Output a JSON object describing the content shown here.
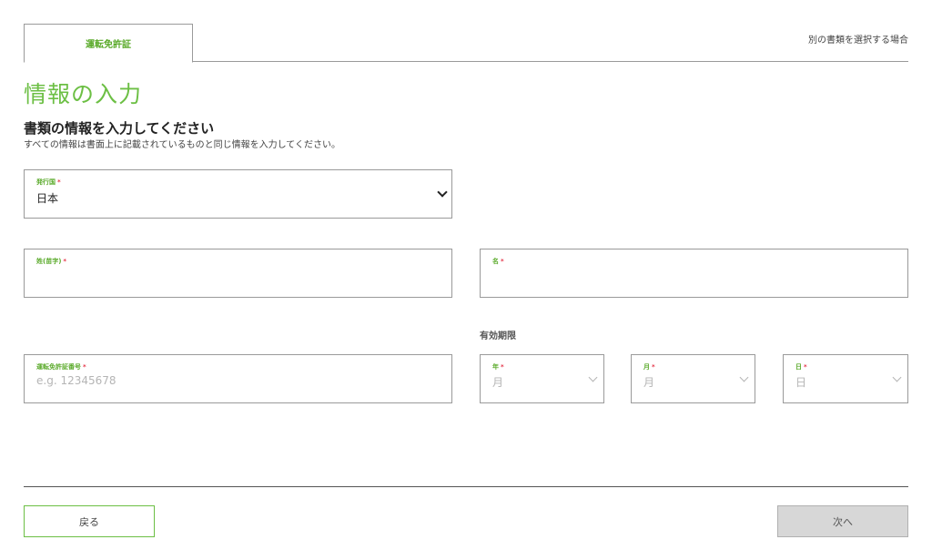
{
  "tabs": {
    "active_label": "運転免許証",
    "alt_link": "別の書類を選択する場合"
  },
  "page_title": "情報の入力",
  "section": {
    "heading": "書類の情報を入力してください",
    "description": "すべての情報は書面上に記載されているものと同じ情報を入力してください。"
  },
  "form": {
    "country": {
      "label": "発行国",
      "required_mark": "*",
      "value": "日本"
    },
    "last_name": {
      "label": "姓(苗字)",
      "required_mark": "*",
      "value": ""
    },
    "first_name": {
      "label": "名",
      "required_mark": "*",
      "value": ""
    },
    "license_number": {
      "label": "運転免許証番号",
      "required_mark": "*",
      "placeholder": "e.g. 12345678"
    },
    "expiry": {
      "label": "有効期限",
      "year": {
        "label": "年",
        "required_mark": "*",
        "placeholder": "月"
      },
      "month": {
        "label": "月",
        "required_mark": "*",
        "placeholder": "月"
      },
      "day": {
        "label": "日",
        "required_mark": "*",
        "placeholder": "日"
      }
    }
  },
  "buttons": {
    "back": "戻る",
    "next": "次へ"
  },
  "colors": {
    "accent_green": "#6cbf44",
    "required_red": "#e5374b",
    "disabled_gray": "#d7d7d7"
  }
}
